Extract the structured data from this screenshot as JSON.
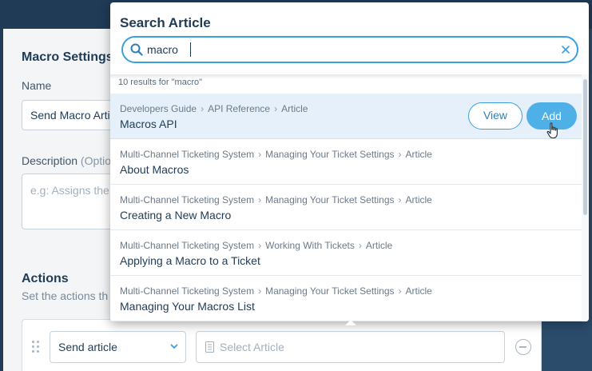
{
  "form": {
    "title": "Macro Settings",
    "name_label": "Name",
    "name_value": "Send Macro Arti",
    "description_label": "Description",
    "description_suffix": "(Optio",
    "description_placeholder": "e.g: Assigns the",
    "actions_title": "Actions",
    "actions_subtitle": "Set the actions th",
    "action_type": "Send article",
    "article_placeholder": "Select Article"
  },
  "popover": {
    "title": "Search Article",
    "query": "macro",
    "results_count": "10 results for \"macro\"",
    "view_label": "View",
    "add_label": "Add",
    "results": [
      {
        "crumbs": [
          "Developers Guide",
          "API Reference",
          "Article"
        ],
        "title": "Macros API",
        "active": true
      },
      {
        "crumbs": [
          "Multi-Channel Ticketing System",
          "Managing Your Ticket Settings",
          "Article"
        ],
        "title": "About Macros"
      },
      {
        "crumbs": [
          "Multi-Channel Ticketing System",
          "Managing Your Ticket Settings",
          "Article"
        ],
        "title": "Creating a New Macro"
      },
      {
        "crumbs": [
          "Multi-Channel Ticketing System",
          "Working With Tickets",
          "Article"
        ],
        "title": "Applying a Macro to a Ticket"
      },
      {
        "crumbs": [
          "Multi-Channel Ticketing System",
          "Managing Your Ticket Settings",
          "Article"
        ],
        "title": "Managing Your Macros List"
      }
    ]
  },
  "colors": {
    "accent": "#3aa0dc",
    "add_button": "#4fb0e8",
    "active_row": "#e5f0fa",
    "text_primary": "#1f3b56",
    "backdrop": "#1f3b56"
  },
  "icons": [
    "search-icon",
    "clear-icon",
    "chevron-down-icon",
    "document-icon",
    "drag-handle-icon",
    "remove-icon",
    "hand-cursor-icon"
  ]
}
